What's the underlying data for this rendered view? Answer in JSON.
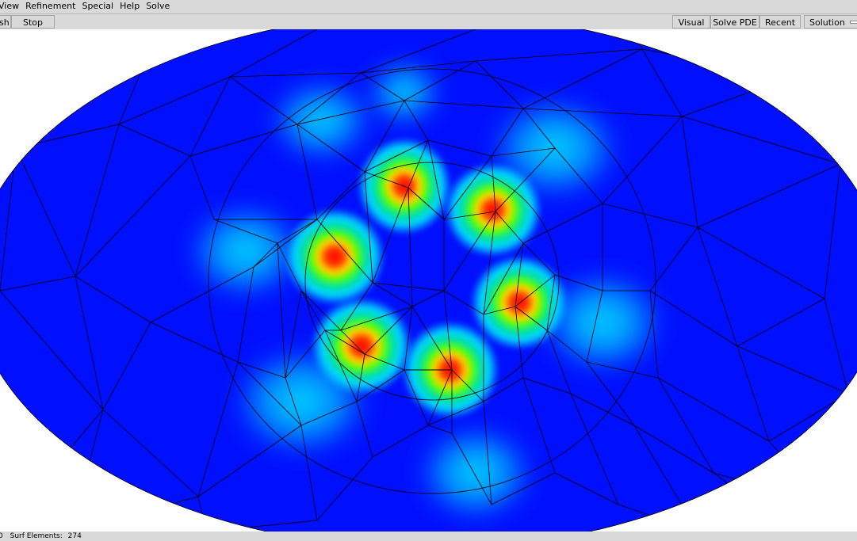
{
  "menu": {
    "items": [
      {
        "label": "View"
      },
      {
        "label": "Refinement"
      },
      {
        "label": "Special"
      },
      {
        "label": "Help"
      },
      {
        "label": "Solve"
      }
    ]
  },
  "toolbar": {
    "mesh_label": "sh",
    "stop_label": "Stop",
    "visual_label": "Visual",
    "solve_pde_label": "Solve PDE",
    "recent_label": "Recent",
    "solution_label": "Solution"
  },
  "viewport": {
    "description_icon": "mesh-solution-view",
    "colormap": [
      "#0000ff",
      "#00ffff",
      "#00ff00",
      "#ffff00",
      "#ff0000"
    ]
  },
  "status": {
    "points_value_fragment": "0",
    "surf_elements_label": "Surf Elements:",
    "surf_elements_value": "274"
  }
}
